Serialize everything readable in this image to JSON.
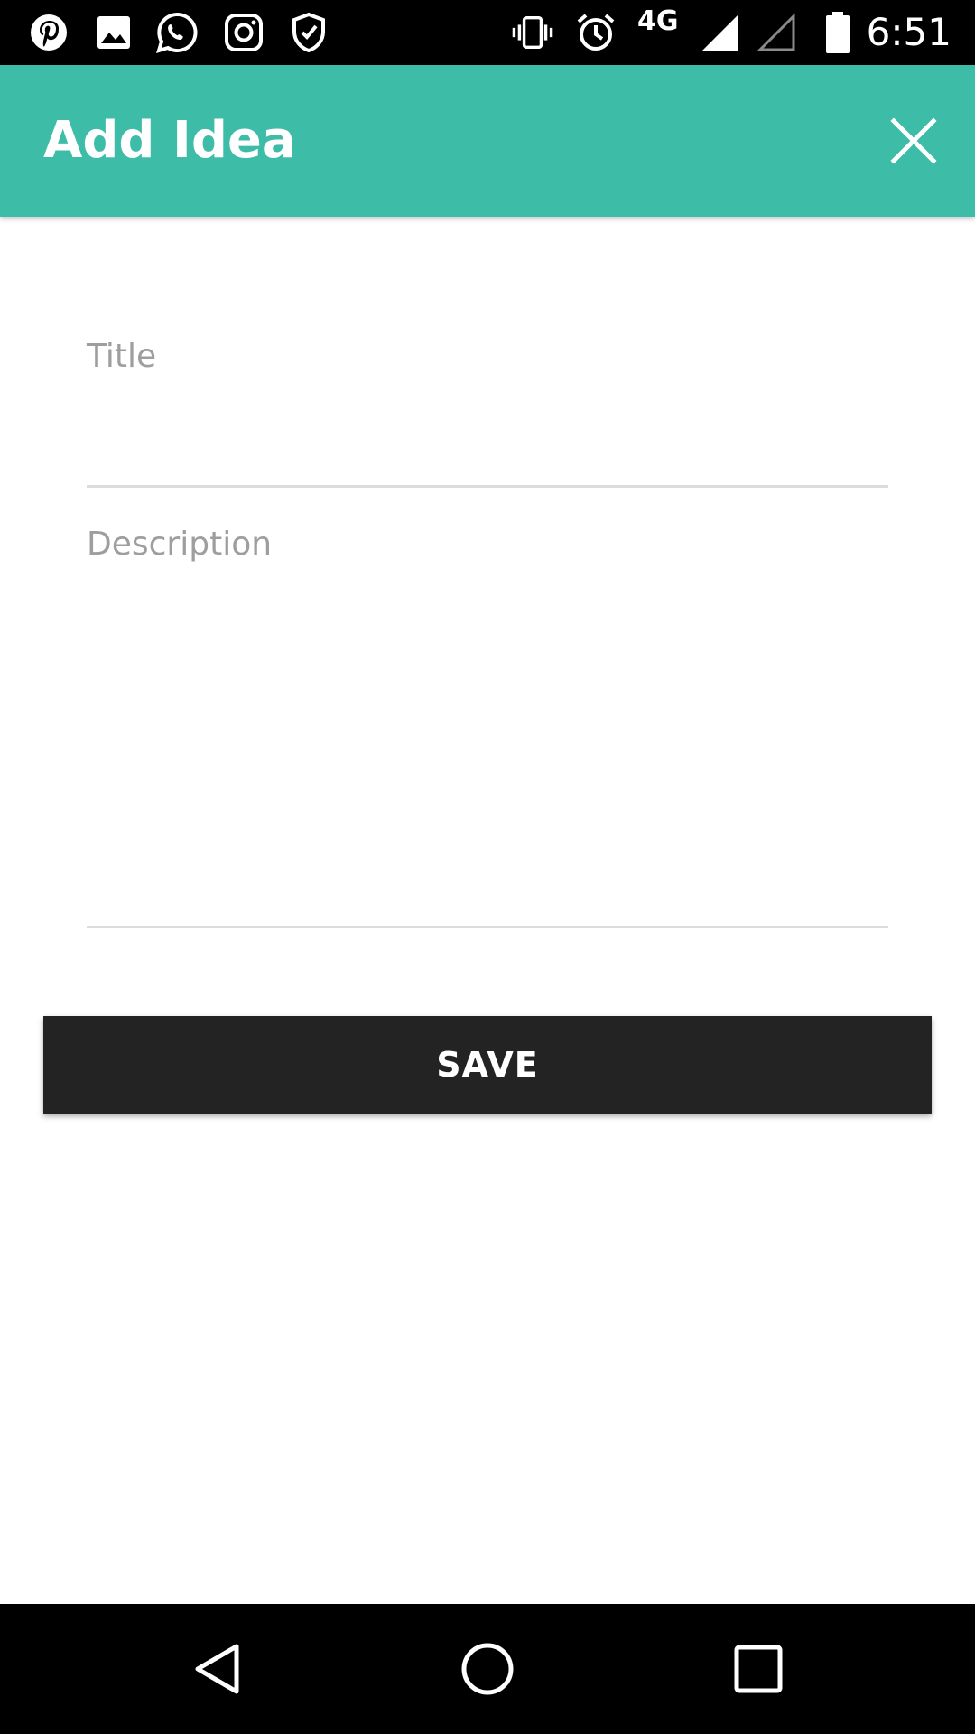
{
  "status_bar": {
    "time": "6:51",
    "network_type": "4G",
    "left_icons": [
      "pinterest-icon",
      "image-icon",
      "whatsapp-icon",
      "instagram-icon",
      "shield-check-icon"
    ],
    "right_icons": [
      "vibrate-icon",
      "alarm-icon",
      "signal-icon",
      "signal-empty-icon",
      "battery-icon"
    ]
  },
  "app_bar": {
    "title": "Add Idea",
    "close_icon": "close-icon",
    "background_color": "#3dbca7"
  },
  "form": {
    "title_field": {
      "label": "Title",
      "value": ""
    },
    "description_field": {
      "label": "Description",
      "value": ""
    },
    "save_label": "SAVE"
  },
  "nav_bar": {
    "icons": [
      "back-icon",
      "home-icon",
      "recents-icon"
    ]
  }
}
